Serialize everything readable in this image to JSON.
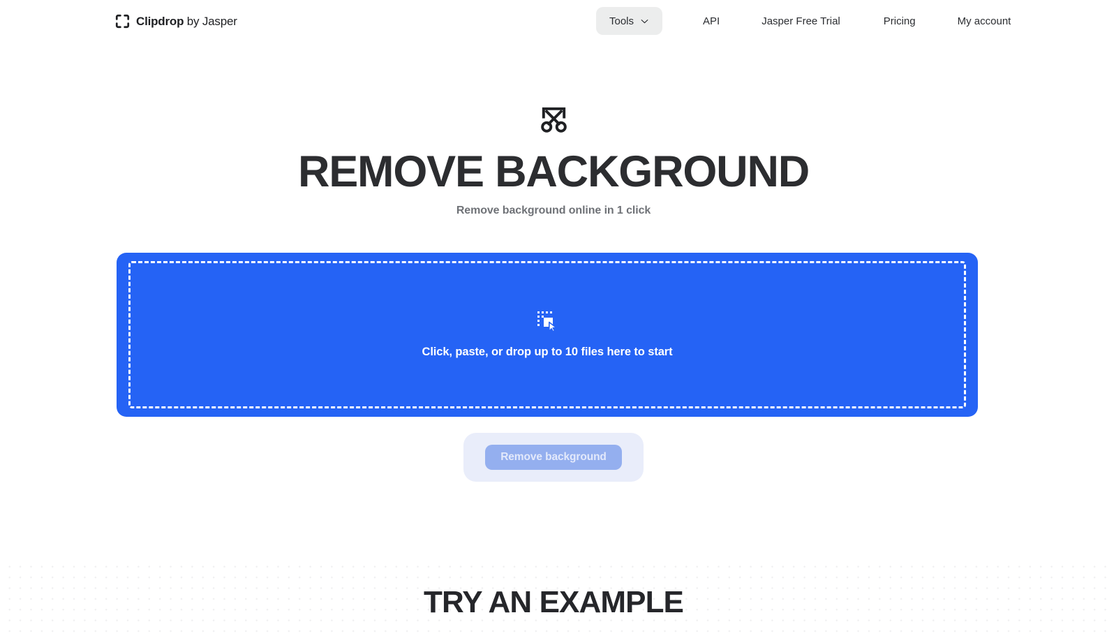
{
  "header": {
    "brand": {
      "icon": "frame-brackets-icon",
      "prefix": "Clipdrop",
      "suffix": " by Jasper"
    },
    "nav": {
      "tools": {
        "label": "Tools",
        "icon": "chevron-down-icon"
      },
      "links": [
        {
          "label": "API"
        },
        {
          "label": "Jasper Free Trial"
        },
        {
          "label": "Pricing"
        },
        {
          "label": "My account"
        }
      ]
    }
  },
  "hero": {
    "icon": "scissors-crop-icon",
    "title": "REMOVE BACKGROUND",
    "subtitle": "Remove background online in 1 click"
  },
  "dropzone": {
    "icon": "drag-drop-files-icon",
    "label": "Click, paste, or drop up to 10 files here to start",
    "max_files": 10
  },
  "action": {
    "label": "Remove background",
    "disabled": true
  },
  "example_section": {
    "title": "TRY AN EXAMPLE"
  },
  "colors": {
    "accent_blue": "#2563f5",
    "button_disabled": "#94afef",
    "button_halo": "#e9edfa",
    "pill_gray": "#eceded",
    "text_dark": "#2c2d30",
    "text_muted": "#6f7277",
    "dot_pattern": "#f0f0f1"
  }
}
